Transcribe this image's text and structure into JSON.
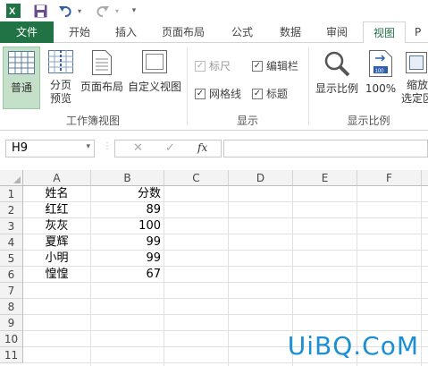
{
  "qat": {
    "app_icon": "excel-icon",
    "save_icon": "save-icon",
    "undo_icon": "undo-icon",
    "redo_icon": "redo-icon",
    "customize_icon": "customize-qat-icon"
  },
  "tabs": [
    {
      "label": "文件"
    },
    {
      "label": "开始"
    },
    {
      "label": "插入"
    },
    {
      "label": "页面布局"
    },
    {
      "label": "公式"
    },
    {
      "label": "数据"
    },
    {
      "label": "审阅"
    },
    {
      "label": "视图"
    },
    {
      "label": "P"
    }
  ],
  "ribbon": {
    "normal": "普通",
    "page_break_1": "分页",
    "page_break_2": "预览",
    "page_layout": "页面布局",
    "custom_view": "自定义视图",
    "group_workbook_views": "工作簿视图",
    "ruler": "标尺",
    "formula_bar": "编辑栏",
    "gridlines": "网格线",
    "headings": "标题",
    "group_show": "显示",
    "zoom": "显示比例",
    "zoom100": "100%",
    "zoom_sel_1": "缩放",
    "zoom_sel_2": "选定区",
    "group_zoom": "显示比例"
  },
  "formula": {
    "name_box": "H9",
    "cancel": "✕",
    "enter": "✓",
    "fx": "fx",
    "content": ""
  },
  "columns": [
    "A",
    "B",
    "C",
    "D",
    "E",
    "F"
  ],
  "rows": [
    "1",
    "2",
    "3",
    "4",
    "5",
    "6",
    "7",
    "8",
    "9",
    "10",
    "11"
  ],
  "cells": [
    [
      "姓名",
      "分数"
    ],
    [
      "红红",
      "89"
    ],
    [
      "灰灰",
      "100"
    ],
    [
      "夏辉",
      "99"
    ],
    [
      "小明",
      "99"
    ],
    [
      "惶惶",
      "67"
    ]
  ],
  "watermark": "UiBQ.CoM",
  "colors": {
    "accent": "#217346",
    "watermark": "#1a8fd6"
  }
}
